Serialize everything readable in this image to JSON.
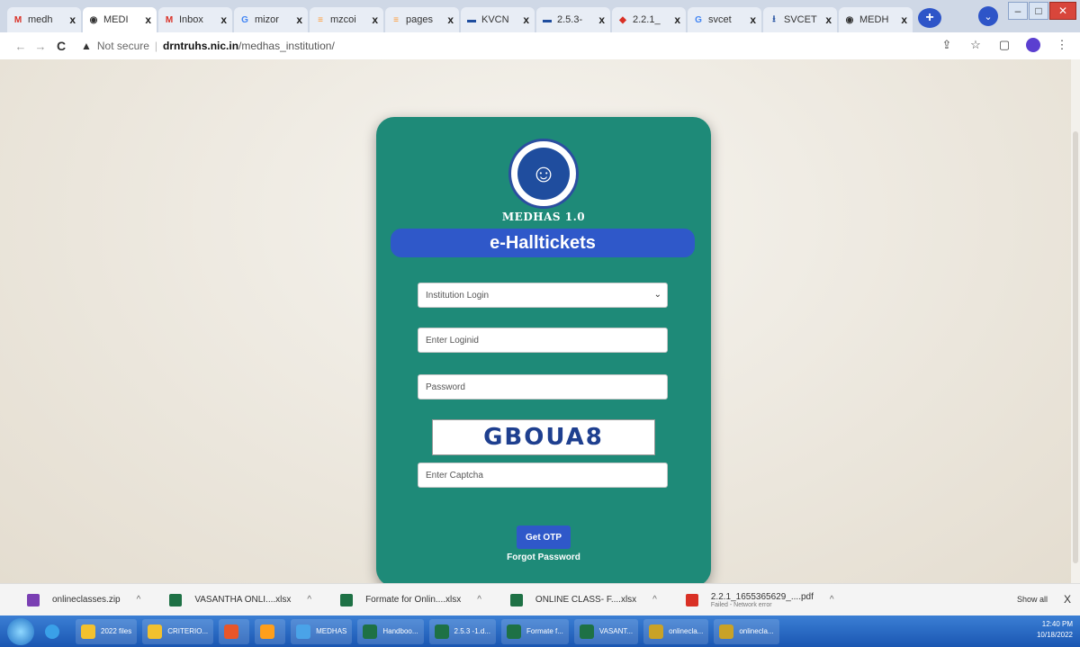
{
  "browser": {
    "tabs": [
      {
        "label": "medh",
        "icon": "gmail-icon",
        "active": false
      },
      {
        "label": "MEDI",
        "icon": "globe-icon",
        "active": true
      },
      {
        "label": "Inbox",
        "icon": "gmail-icon",
        "active": false
      },
      {
        "label": "mizor",
        "icon": "google-icon",
        "active": false
      },
      {
        "label": "mzcoi",
        "icon": "india-flag-icon",
        "active": false
      },
      {
        "label": "pages",
        "icon": "india-flag-icon",
        "active": false
      },
      {
        "label": "KVCN",
        "icon": "site-icon",
        "active": false
      },
      {
        "label": "2.5.3-",
        "icon": "site-icon",
        "active": false
      },
      {
        "label": "2.2.1_",
        "icon": "pdf-icon",
        "active": false
      },
      {
        "label": "svcet",
        "icon": "google-icon",
        "active": false
      },
      {
        "label": "SVCET",
        "icon": "download-icon",
        "active": false
      },
      {
        "label": "MEDH",
        "icon": "globe-icon",
        "active": false
      }
    ],
    "tab_close": "x",
    "new_tab": "+",
    "address": {
      "security": "Not secure",
      "host": "drntruhs.nic.in",
      "path": "/medhas_institution/"
    }
  },
  "login": {
    "brand": "MEDHAS 1.0",
    "banner": "e-Halltickets",
    "login_type": "Institution Login",
    "loginid_placeholder": "Enter Loginid",
    "password_placeholder": "Password",
    "captcha_text": "GBOUA8",
    "captcha_placeholder": "Enter Captcha",
    "otp_button": "Get OTP",
    "forgot_link": "Forgot Password"
  },
  "downloads": {
    "items": [
      {
        "name": "onlineclasses.zip",
        "color": "#7a3fb3",
        "sub": ""
      },
      {
        "name": "VASANTHA ONLI....xlsx",
        "color": "#1e7145",
        "sub": ""
      },
      {
        "name": "Formate for Onlin....xlsx",
        "color": "#1e7145",
        "sub": ""
      },
      {
        "name": "ONLINE CLASS- F....xlsx",
        "color": "#1e7145",
        "sub": ""
      },
      {
        "name": "2.2.1_1655365629_....pdf",
        "color": "#d93025",
        "sub": "Failed - Network error"
      }
    ],
    "show_all": "Show all",
    "close": "X"
  },
  "taskbar": {
    "items": [
      {
        "label": "2022 files",
        "color": "#f2c12e"
      },
      {
        "label": "CRITERIO...",
        "color": "#f2c12e"
      },
      {
        "label": "",
        "color": "#e8562a"
      },
      {
        "label": "",
        "color": "#ff9f1c"
      },
      {
        "label": "MEDHAS",
        "color": "#4aa3e8"
      },
      {
        "label": "Handboo...",
        "color": "#1e7145"
      },
      {
        "label": "2.5.3 -1.d...",
        "color": "#1e7145"
      },
      {
        "label": "Formate f...",
        "color": "#1e7145"
      },
      {
        "label": "VASANT...",
        "color": "#1e7145"
      },
      {
        "label": "onlinecla...",
        "color": "#c9a227"
      },
      {
        "label": "onlinecla...",
        "color": "#c9a227"
      }
    ],
    "time": "12:40 PM",
    "date": "10/18/2022"
  }
}
